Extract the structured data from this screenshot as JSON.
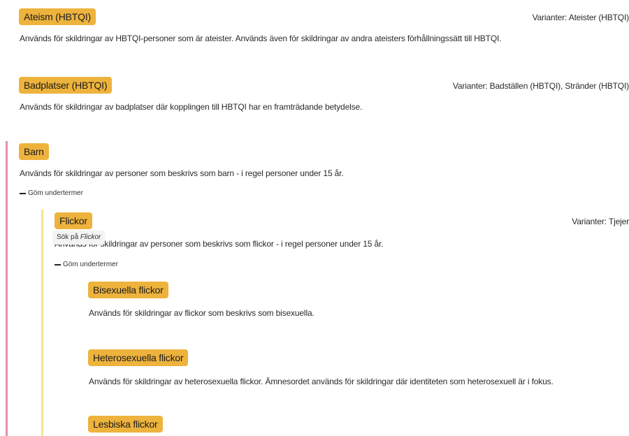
{
  "colors": {
    "tag_bg": "#eeb33d",
    "level1_bar": "#e58fb4",
    "level2_bar": "#f4e68a"
  },
  "terms": {
    "ateism": {
      "label": "Ateism (HBTQI)",
      "variants": "Varianter: Ateister (HBTQI)",
      "description": "Används för skildringar av HBTQI-personer som är ateister. Används även för skildringar av andra ateisters förhållningssätt till HBTQI."
    },
    "badplatser": {
      "label": "Badplatser (HBTQI)",
      "variants": "Varianter: Badställen (HBTQI), Stränder (HBTQI)",
      "description": "Används för skildringar av badplatser där kopplingen till HBTQI har en framträdande betydelse."
    },
    "barn": {
      "label": "Barn",
      "description": "Används för skildringar av personer som beskrivs som barn - i regel personer under 15 år.",
      "toggle": "Göm undertermer"
    },
    "flickor": {
      "label": "Flickor",
      "variants": "Varianter: Tjejer",
      "description": "Används för skildringar av personer som beskrivs som flickor - i regel personer under 15 år.",
      "toggle": "Göm undertermer",
      "tooltip_prefix": "Sök på",
      "tooltip_term": "Flickor"
    },
    "bisexuella_flickor": {
      "label": "Bisexuella flickor",
      "description": "Används för skildringar av flickor som beskrivs som bisexuella."
    },
    "heterosexuella_flickor": {
      "label": "Heterosexuella flickor",
      "description": "Används för skildringar av heterosexuella flickor. Ämnesordet används för skildringar där identiteten som heterosexuell är i fokus."
    },
    "lesbiska_flickor": {
      "label": "Lesbiska flickor"
    }
  }
}
